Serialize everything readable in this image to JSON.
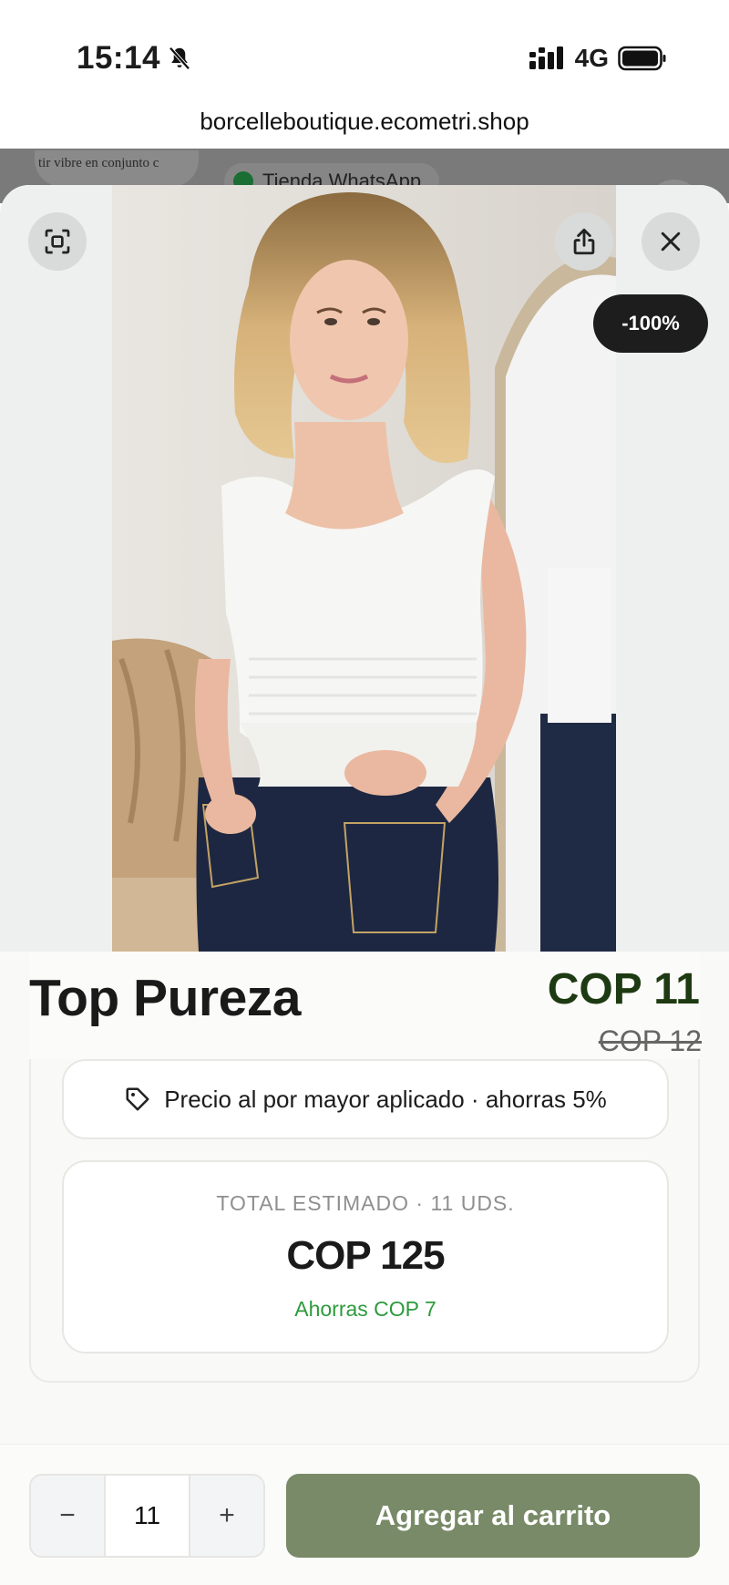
{
  "status_bar": {
    "time": "15:14",
    "network": "4G",
    "icons": [
      "bell-slash-icon",
      "signal-icon",
      "battery-icon"
    ]
  },
  "browser": {
    "url": "borcelleboutique.ecometri.shop"
  },
  "background_page": {
    "banner_text": "tir vibre en conjunto c",
    "whatsapp_chip": "Tienda WhatsApp"
  },
  "product_modal": {
    "buttons": {
      "expand_icon": "expand-icon",
      "share_icon": "share-icon",
      "close_icon": "close-icon"
    },
    "discount_badge": "-100%",
    "title": "Top Pureza",
    "price_current": "COP 11",
    "price_original": "COP 12",
    "wholesale_notice": "Precio al por mayor aplicado · ahorras 5%",
    "total": {
      "label": "TOTAL ESTIMADO · 11 UDS.",
      "value": "COP 125",
      "savings": "Ahorras COP 7"
    }
  },
  "cart_bar": {
    "decrement_label": "−",
    "quantity": "11",
    "increment_label": "+",
    "add_button_label": "Agregar al carrito"
  },
  "colors": {
    "primary_button": "#788a67",
    "price": "#1e3a12",
    "savings": "#2d9a3d",
    "badge": "#1d1d1d"
  }
}
